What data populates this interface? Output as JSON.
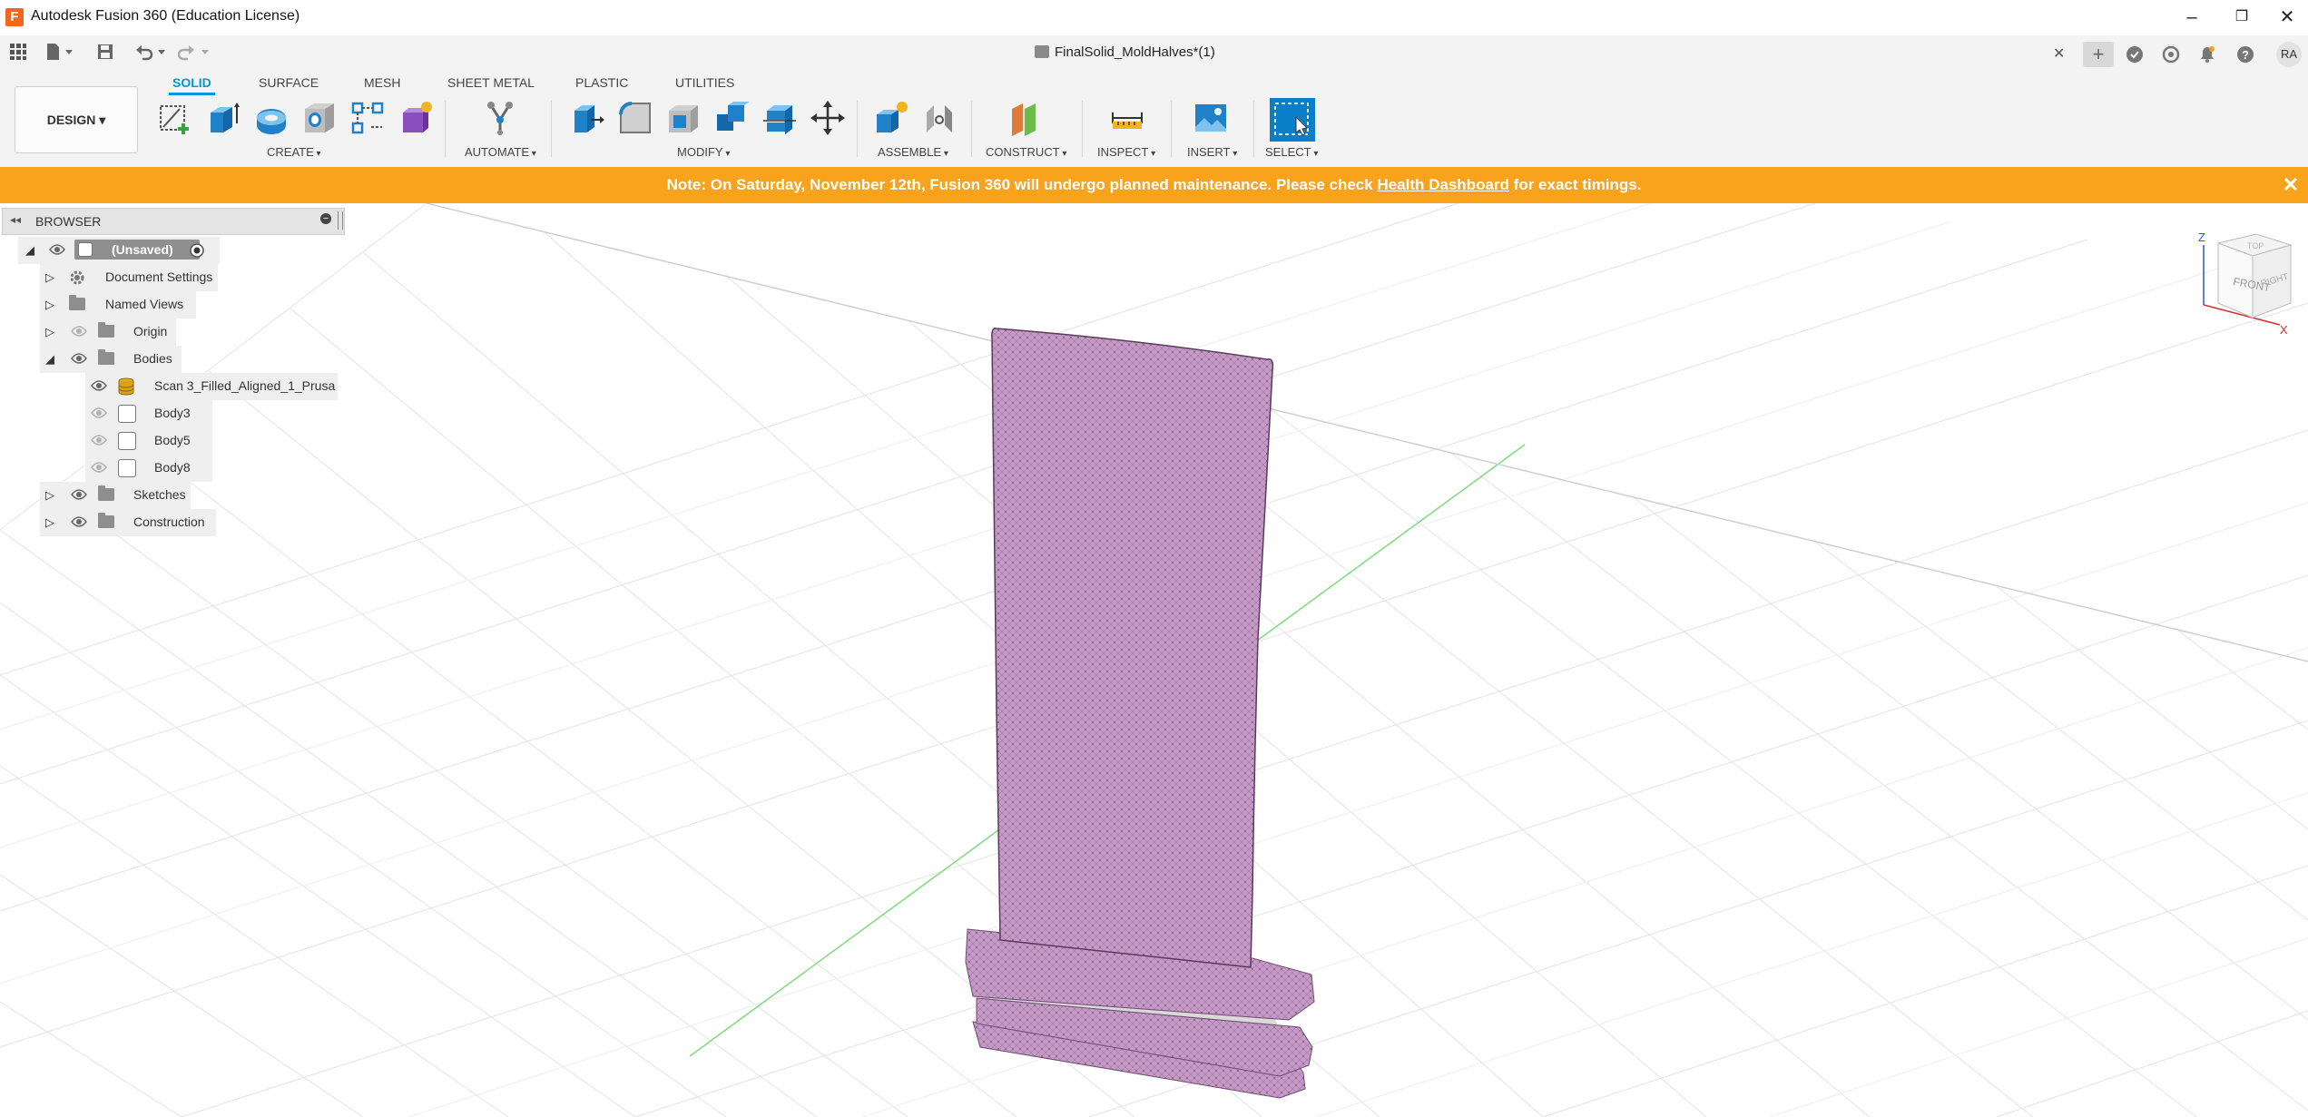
{
  "window": {
    "title": "Autodesk Fusion 360 (Education License)",
    "minimize": "–",
    "restore": "❐",
    "close": "✕"
  },
  "qat": {
    "apps_icon": "grid-icon",
    "file_icon": "file-icon",
    "save_icon": "save-icon",
    "undo_icon": "undo-icon",
    "redo_icon": "redo-icon"
  },
  "document_tab": {
    "name": "FinalSolid_MoldHalves*(1)",
    "close": "✕"
  },
  "user": {
    "initials": "RA"
  },
  "workspace": {
    "label": "DESIGN ▾"
  },
  "ribbon_tabs": [
    "SOLID",
    "SURFACE",
    "MESH",
    "SHEET METAL",
    "PLASTIC",
    "UTILITIES"
  ],
  "ribbon_groups": [
    "CREATE",
    "AUTOMATE",
    "MODIFY",
    "ASSEMBLE",
    "CONSTRUCT",
    "INSPECT",
    "INSERT",
    "SELECT"
  ],
  "notice": {
    "prefix": "Note: On Saturday, November 12th, Fusion 360 will undergo planned maintenance. Please check",
    "link": "Health Dashboard",
    "suffix": "for exact timings.",
    "close": "✕"
  },
  "browser": {
    "title": "BROWSER",
    "root": "(Unsaved)",
    "items": [
      "Document Settings",
      "Named Views",
      "Origin",
      "Bodies",
      "Scan 3_Filled_Aligned_1_Prusa",
      "Body3",
      "Body5",
      "Body8",
      "Sketches",
      "Construction"
    ]
  },
  "viewcube": {
    "front": "FRONT",
    "right": "RIGHT",
    "top": "TOP",
    "axis_z": "Z",
    "axis_x": "X"
  },
  "colors": {
    "accent": "#0696d7",
    "notice": "#f9a21b",
    "model": "#c79bc8"
  }
}
